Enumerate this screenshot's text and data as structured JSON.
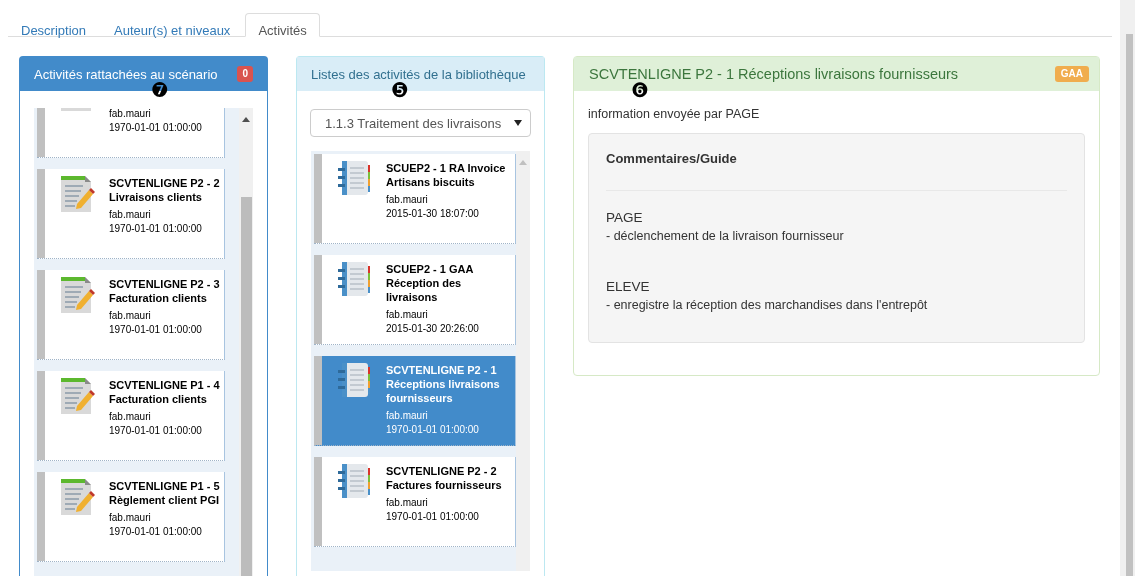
{
  "tabs": [
    {
      "label": "Description",
      "selected": false
    },
    {
      "label": "Auteur(s) et niveaux",
      "selected": false
    },
    {
      "label": "Activités",
      "selected": true
    }
  ],
  "scenario_panel": {
    "title": "Activités rattachées au scénario",
    "badge": "0",
    "callout": "❼",
    "items": [
      {
        "author": "fab.mauri",
        "date": "1970-01-01 01:00:00",
        "selected": false,
        "cropped": true
      },
      {
        "title": "SCVTENLIGNE P2 - 2 Livraisons clients",
        "author": "fab.mauri",
        "date": "1970-01-01 01:00:00",
        "selected": false,
        "cropped": false
      },
      {
        "title": "SCVTENLIGNE P2 - 3 Facturation clients",
        "author": "fab.mauri",
        "date": "1970-01-01 01:00:00",
        "selected": false,
        "cropped": false
      },
      {
        "title": "SCVTENLIGNE P1 - 4 Facturation clients",
        "author": "fab.mauri",
        "date": "1970-01-01 01:00:00",
        "selected": false,
        "cropped": false
      },
      {
        "title": "SCVTENLIGNE P1 - 5 Règlement client PGI",
        "author": "fab.mauri",
        "date": "1970-01-01 01:00:00",
        "selected": false,
        "cropped": false
      }
    ]
  },
  "library_panel": {
    "title": "Listes des activités de la bibliothèque",
    "callout": "❺",
    "dropdown": {
      "value": "1.1.3 Traitement des livraisons"
    },
    "items": [
      {
        "title": "SCUEP2 - 1 RA Invoice Artisans biscuits",
        "author": "fab.mauri",
        "date": "2015-01-30 18:07:00",
        "selected": false
      },
      {
        "title": "SCUEP2 - 1 GAA Réception des livraisons",
        "author": "fab.mauri",
        "date": "2015-01-30 20:26:00",
        "selected": false
      },
      {
        "title": "SCVTENLIGNE P2 - 1 Réceptions livraisons fournisseurs",
        "author": "fab.mauri",
        "date": "1970-01-01 01:00:00",
        "selected": true
      },
      {
        "title": "SCVTENLIGNE P2 - 2 Factures fournisseurs",
        "author": "fab.mauri",
        "date": "1970-01-01 01:00:00",
        "selected": false
      }
    ]
  },
  "detail_panel": {
    "title": "SCVTENLIGNE P2 - 1 Réceptions livraisons fournisseurs",
    "badge": "GAA",
    "callout": "❻",
    "info": "information envoyée par PAGE",
    "guide": {
      "heading": "Commentaires/Guide",
      "sections": [
        {
          "role": "PAGE",
          "text": "- déclenchement de la livraison fournisseur"
        },
        {
          "role": "ELEVE",
          "text": "- enregistre la réception des marchandises dans l'entrepôt"
        }
      ]
    }
  }
}
